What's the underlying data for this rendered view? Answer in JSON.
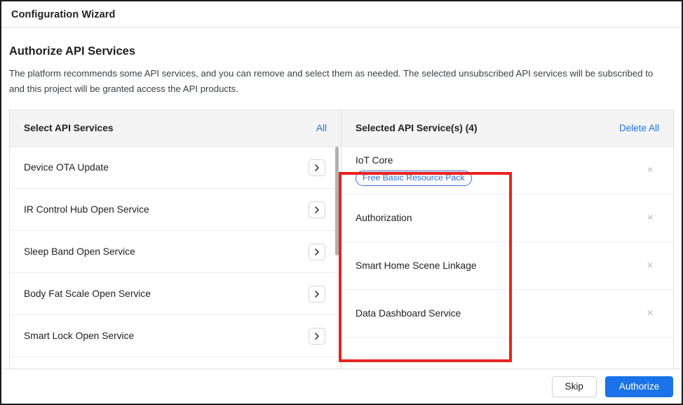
{
  "window": {
    "title": "Configuration Wizard"
  },
  "page": {
    "heading": "Authorize API Services",
    "description": "The platform recommends some API services, and you can remove and select them as needed. The selected unsubscribed API services will be subscribed to and this project will be granted access the API products."
  },
  "left_panel": {
    "header_label": "Select API Services",
    "header_action": "All",
    "add_icon": "chevron-right-icon",
    "items": [
      {
        "name": "Device OTA Update"
      },
      {
        "name": "IR Control Hub Open Service"
      },
      {
        "name": "Sleep Band Open Service"
      },
      {
        "name": "Body Fat Scale Open Service"
      },
      {
        "name": "Smart Lock Open Service"
      },
      {
        "name": ""
      }
    ]
  },
  "right_panel": {
    "header_label": "Selected API Service(s) (4)",
    "header_action": "Delete All",
    "selected_count": 4,
    "remove_icon": "close-x-icon",
    "items": [
      {
        "name": "IoT Core",
        "badge": "Free Basic Resource Pack",
        "remove": "×"
      },
      {
        "name": "Authorization",
        "badge": "",
        "remove": "×"
      },
      {
        "name": "Smart Home Scene Linkage",
        "badge": "",
        "remove": "×"
      },
      {
        "name": "Data Dashboard Service",
        "badge": "",
        "remove": "×"
      }
    ]
  },
  "highlight": {
    "name": "red-annotation-box",
    "color": "#e8231f"
  },
  "footer": {
    "skip_label": "Skip",
    "authorize_label": "Authorize"
  },
  "colors": {
    "accent_blue": "#1a73e8",
    "badge_blue": "#2a6ae0",
    "header_bg": "#f4f4f4",
    "border": "#e0e0e0",
    "annotation_red": "#e8231f"
  }
}
